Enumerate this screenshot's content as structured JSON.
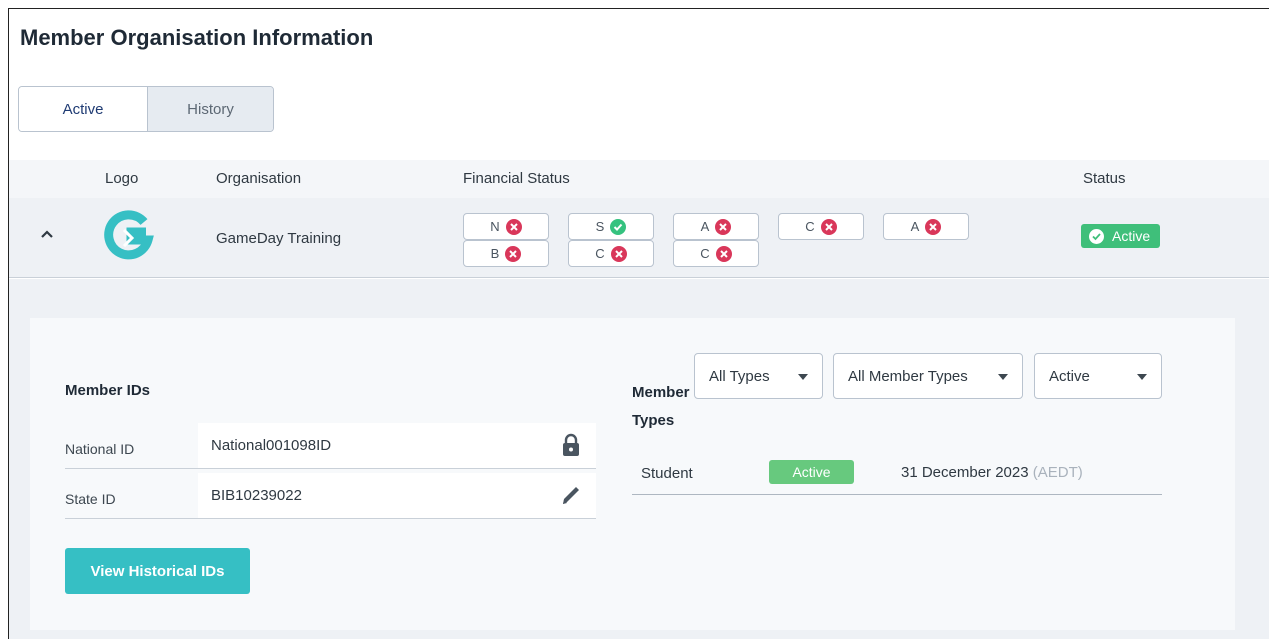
{
  "page": {
    "title": "Member Organisation Information"
  },
  "tabs": [
    {
      "label": "Active",
      "active": true
    },
    {
      "label": "History",
      "active": false
    }
  ],
  "table": {
    "headers": {
      "logo": "Logo",
      "organisation": "Organisation",
      "financial_status": "Financial Status",
      "status": "Status"
    },
    "row": {
      "organisation": "GameDay Training",
      "status": "Active",
      "financial_pills": [
        {
          "label": "N",
          "state": "x"
        },
        {
          "label": "S",
          "state": "ok"
        },
        {
          "label": "A",
          "state": "x"
        },
        {
          "label": "C",
          "state": "x"
        },
        {
          "label": "A",
          "state": "x"
        },
        {
          "label": "B",
          "state": "x"
        },
        {
          "label": "C",
          "state": "x"
        },
        {
          "label": "C",
          "state": "x"
        }
      ]
    }
  },
  "member_ids": {
    "title": "Member IDs",
    "rows": [
      {
        "label": "National ID",
        "value": "National001098ID",
        "icon": "lock-icon"
      },
      {
        "label": "State ID",
        "value": "BIB10239022",
        "icon": "pencil-icon"
      }
    ],
    "button": "View Historical IDs"
  },
  "member_types": {
    "title": "Member Types",
    "filters": [
      "All Types",
      "All Member Types",
      "Active"
    ],
    "rows": [
      {
        "name": "Student",
        "status": "Active",
        "date": "31 December 2023",
        "tz": "(AEDT)"
      }
    ]
  },
  "colors": {
    "accent": "#36bfc4",
    "active_green": "#3fbf7a",
    "error_red": "#d9375a",
    "ok_green": "#35c27f"
  }
}
